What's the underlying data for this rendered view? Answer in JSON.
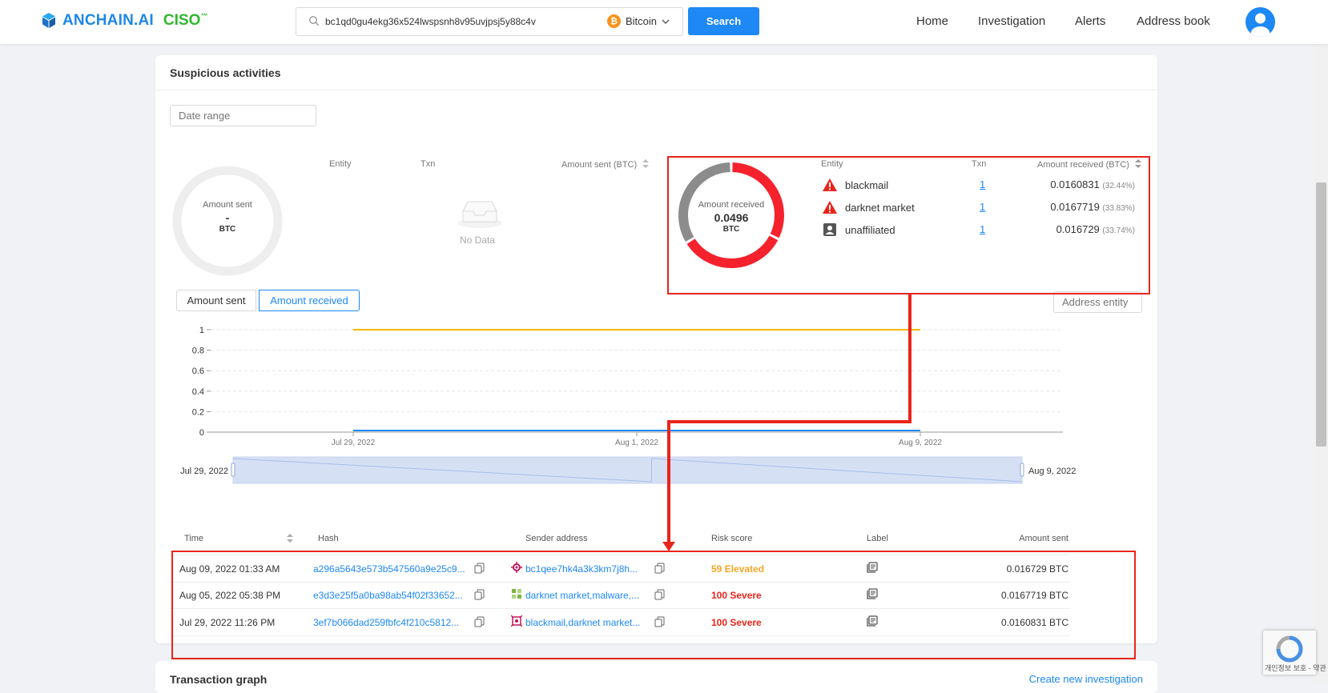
{
  "header": {
    "logo_text": "ANCHAIN.AI",
    "logo_ciso": "CISO",
    "logo_tm": "™",
    "search_value": "bc1qd0gu4ekg36x524lwspsnh8v95uvjpsj5y88c4v",
    "chain_label": "Bitcoin",
    "search_button": "Search",
    "nav": [
      "Home",
      "Investigation",
      "Alerts",
      "Address book"
    ]
  },
  "suspicious": {
    "title": "Suspicious activities",
    "date_range_placeholder": "Date range",
    "sent": {
      "donut_label": "Amount sent",
      "donut_value": "-",
      "donut_unit": "BTC",
      "col_entity": "Entity",
      "col_txn": "Txn",
      "col_amount": "Amount sent (BTC)",
      "empty_text": "No Data"
    },
    "received": {
      "donut_label": "Amount received",
      "donut_value": "0.0496",
      "donut_unit": "BTC",
      "col_entity": "Entity",
      "col_txn": "Txn",
      "col_amount": "Amount received (BTC)",
      "entities": [
        {
          "name": "blackmail",
          "icon": "warning-icon",
          "txn": "1",
          "amount": "0.0160831",
          "pct": "(32.44%)",
          "color": "#e8251a"
        },
        {
          "name": "darknet market",
          "icon": "warning-icon",
          "txn": "1",
          "amount": "0.0167719",
          "pct": "(33.83%)",
          "color": "#e8251a"
        },
        {
          "name": "unaffiliated",
          "icon": "contact-icon",
          "txn": "1",
          "amount": "0.016729",
          "pct": "(33.74%)",
          "color": "#9e9e9e"
        }
      ]
    },
    "tabs": {
      "sent": "Amount sent",
      "received": "Amount received"
    },
    "address_entity_placeholder": "Address entity",
    "table": {
      "headers": {
        "time": "Time",
        "hash": "Hash",
        "sender": "Sender address",
        "risk": "Risk score",
        "label": "Label",
        "amount": "Amount sent"
      },
      "rows": [
        {
          "time": "Aug 09, 2022 01:33 AM",
          "hash": "a296a5643e573b547560a9e25c9...",
          "sender": "bc1qee7hk4a3k3km7j8h...",
          "risk": "59 Elevated",
          "risk_level": "elevated",
          "amount": "0.016729 BTC"
        },
        {
          "time": "Aug 05, 2022 05:38 PM",
          "hash": "e3d3e25f5a0ba98ab54f02f33652...",
          "sender": "darknet market,malware,...",
          "risk": "100 Severe",
          "risk_level": "severe",
          "amount": "0.0167719 BTC"
        },
        {
          "time": "Jul 29, 2022 11:26 PM",
          "hash": "3ef7b066dad259fbfc4f210c5812...",
          "sender": "blackmail,darknet market...",
          "risk": "100 Severe",
          "risk_level": "severe",
          "amount": "0.0160831 BTC"
        }
      ]
    }
  },
  "chart_data": [
    {
      "type": "pie",
      "title": "Amount received",
      "labels": [
        "blackmail",
        "darknet market",
        "unaffiliated"
      ],
      "values": [
        0.0160831,
        0.0167719,
        0.016729
      ],
      "colors": [
        "#f5222d",
        "#f5222d",
        "#8c8c8c"
      ]
    },
    {
      "type": "line",
      "x": [
        "Jul 29, 2022",
        "Aug 9, 2022"
      ],
      "x_ticks": [
        "Jul 29, 2022",
        "Aug 1, 2022",
        "Aug 9, 2022"
      ],
      "y_ticks": [
        "0",
        "0.2",
        "0.4",
        "0.6",
        "0.8",
        "1"
      ],
      "ylim": [
        0,
        1
      ],
      "series": [
        {
          "values": [
            1,
            1
          ],
          "color": "#f5b700"
        },
        {
          "values": [
            0.016,
            0.016
          ],
          "color": "#1e88f5"
        }
      ],
      "grid": true,
      "slider_labels": [
        "Jul 29, 2022",
        "Aug 9, 2022"
      ]
    }
  ],
  "transaction_graph": {
    "title": "Transaction graph",
    "create_link": "Create new investigation"
  },
  "recaptcha_text": "개인정보 보호 - 약관"
}
